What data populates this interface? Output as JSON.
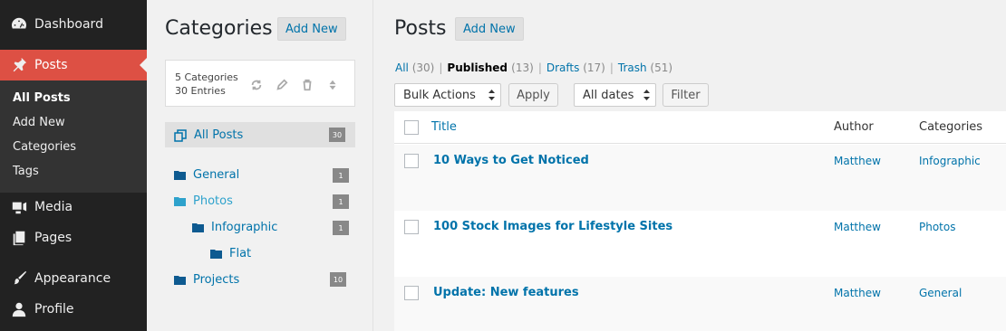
{
  "sidebar": {
    "items": [
      {
        "label": "Dashboard",
        "icon": "dashboard-icon"
      },
      {
        "label": "Posts",
        "icon": "pin-icon",
        "active": true
      },
      {
        "label": "Media",
        "icon": "media-icon"
      },
      {
        "label": "Pages",
        "icon": "pages-icon"
      },
      {
        "label": "Appearance",
        "icon": "brush-icon"
      },
      {
        "label": "Profile",
        "icon": "user-icon"
      }
    ],
    "submenu": [
      "All Posts",
      "Add New",
      "Categories",
      "Tags"
    ],
    "accent": "#dd5044"
  },
  "categories": {
    "title": "Categories",
    "add_new": "Add New",
    "stats": {
      "line1": "5 Categories",
      "line2": "30 Entries"
    },
    "all_posts": {
      "label": "All Posts",
      "count": "30"
    },
    "tree": [
      {
        "label": "General",
        "count": "1"
      },
      {
        "label": "Photos",
        "count": "1"
      },
      {
        "label": "Infographic",
        "count": "1"
      },
      {
        "label": "Flat",
        "count": ""
      },
      {
        "label": "Projects",
        "count": "10"
      }
    ]
  },
  "posts": {
    "title": "Posts",
    "add_new": "Add New",
    "filters": [
      {
        "label": "All",
        "count": "(30)"
      },
      {
        "label": "Published",
        "count": "(13)"
      },
      {
        "label": "Drafts",
        "count": "(17)"
      },
      {
        "label": "Trash",
        "count": "(51)"
      }
    ],
    "bulk_actions": "Bulk Actions",
    "apply": "Apply",
    "dates": "All dates",
    "filter": "Filter",
    "columns": [
      "Title",
      "Author",
      "Categories"
    ],
    "rows": [
      {
        "title": "10 Ways to Get Noticed",
        "author": "Matthew",
        "category": "Infographic"
      },
      {
        "title": "100 Stock Images for Lifestyle Sites",
        "author": "Matthew",
        "category": "Photos"
      },
      {
        "title": "Update: New features",
        "author": "Matthew",
        "category": "General"
      }
    ]
  }
}
